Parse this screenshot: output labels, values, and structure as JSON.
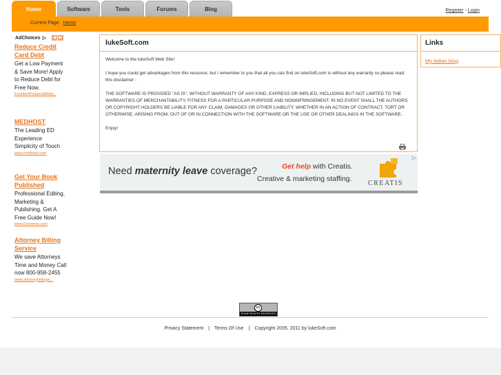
{
  "tabs": [
    {
      "label": "Home",
      "active": true
    },
    {
      "label": "Software",
      "active": false
    },
    {
      "label": "Tools",
      "active": false
    },
    {
      "label": "Forums",
      "active": false
    },
    {
      "label": "Blog",
      "active": false
    }
  ],
  "top_links": {
    "register": "Register",
    "separator": "-",
    "login": "Login"
  },
  "breadcrumb": {
    "label": "Current Page:",
    "current": "Home"
  },
  "adchoices": {
    "label": "AdChoices",
    "icon": "adchoices-triangle-icon"
  },
  "ads": [
    {
      "title": "Reduce Credit Card Debt",
      "text": "Get a Low Payment & Save More! Apply to Reduce Debt for Free Now.",
      "url": "FreedomFinancialNetw..."
    },
    {
      "title": "MEDHOST",
      "text": "The Leading ED Experience Simplicity of Touch",
      "url": "www.medhost.com"
    },
    {
      "title": "Get Your Book Published",
      "text": "Professional Editing, Marketing & Publishing. Get A Free Guide Now!",
      "url": "www.iUniverse.com"
    },
    {
      "title": "Attorney Billing Service",
      "text": "We save Attorneys Time and Money Call now 800-958-2455",
      "url": "www.attorneybillinger..."
    }
  ],
  "main": {
    "title": "lukeSoft.com",
    "paragraphs": [
      "Welcome to the lukeSoft Web Site!",
      "I hope you could get advantages from this resource, but i remember to you that all you can find on lukeSoft.com is without any warranty so please read this disclaimer :",
      "THE SOFTWARE IS PROVIDED \"AS IS\", WITHOUT WARRANTY OF ANY KIND, EXPRESS OR IMPLIED, INCLUDING BUT NOT LIMITED TO THE WARRANTIES OF MERCHANTABILITY, FITNESS FOR A PARTICULAR PURPOSE AND NONINFRINGEMENT. IN NO EVENT SHALL THE AUTHORS OR COPYRIGHT HOLDERS BE LIABLE FOR ANY CLAIM, DAMAGES OR OTHER LIABILITY, WHETHER IN AN ACTION OF CONTRACT, TORT OR OTHERWISE, ARISING FROM, OUT OF OR IN CONNECTION WITH THE SOFTWARE OR THE USE OR OTHER DEALINGS IN THE SOFTWARE.",
      "Enjoy!"
    ]
  },
  "banner": {
    "need_prefix": "Need ",
    "need_bold": "maternity leave",
    "need_suffix": " coverage?",
    "gethelp_bold": "Get help",
    "gethelp_rest": " with Creatis.",
    "creative": "Creative & marketing staffing.",
    "brand": "CREATIS"
  },
  "links": {
    "title": "Links",
    "items": [
      "My italian blog"
    ]
  },
  "cc": {
    "symbol": "cc",
    "text": "SOME RIGHTS RESERVED"
  },
  "footer": {
    "privacy": "Privacy Statement",
    "sep": "|",
    "terms": "Terms Of Use",
    "copyright": "Copyright 2005, 2011 by lukeSoft.com"
  },
  "colors": {
    "accent": "#ff9a00",
    "link": "#e8751a",
    "box_border": "#f2b266"
  }
}
